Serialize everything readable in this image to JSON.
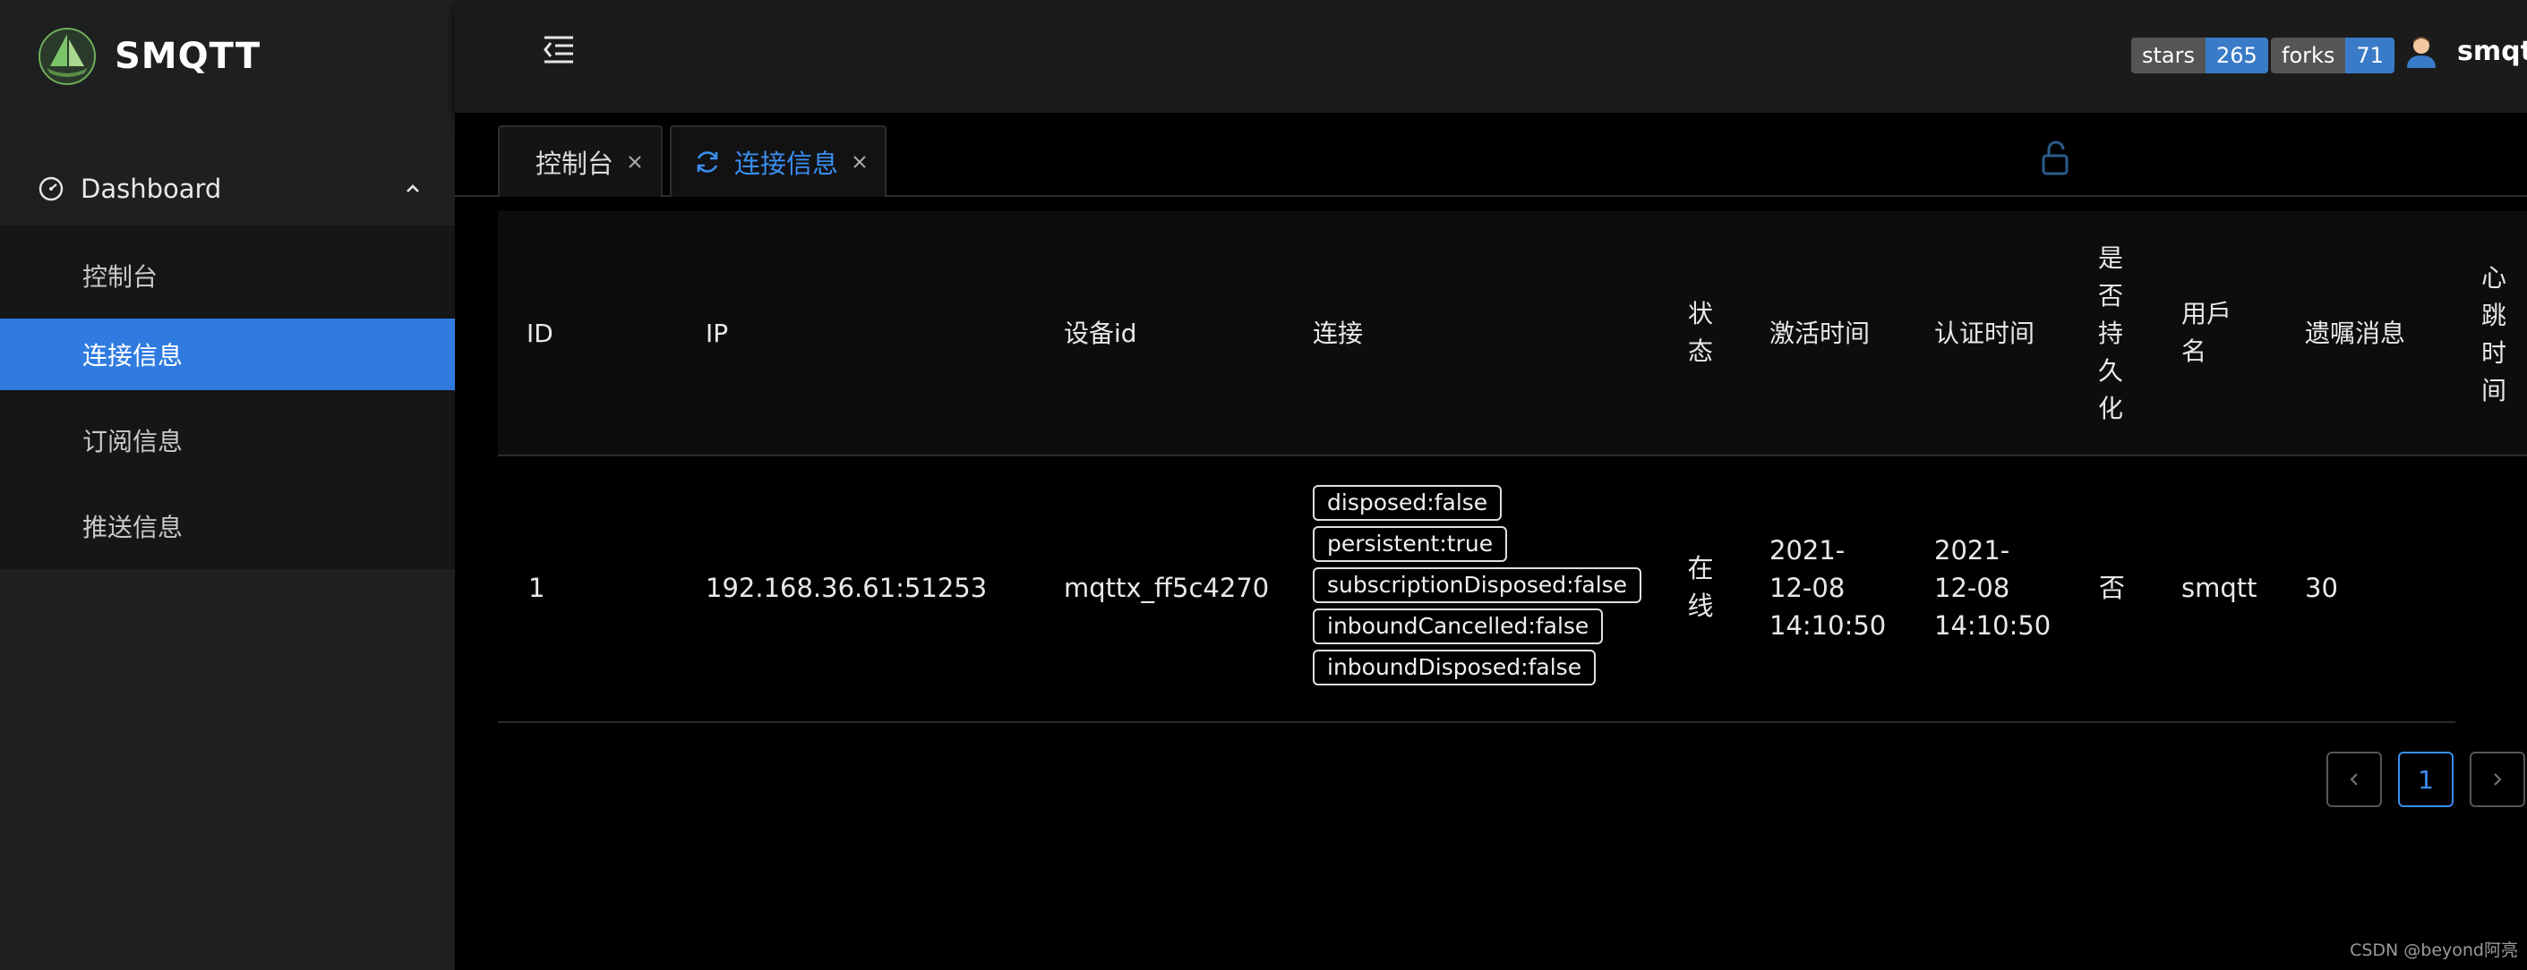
{
  "app": {
    "title": "SMQTT"
  },
  "sidebar": {
    "group_label": "Dashboard",
    "items": [
      {
        "label": "控制台"
      },
      {
        "label": "连接信息"
      },
      {
        "label": "订阅信息"
      },
      {
        "label": "推送信息"
      }
    ],
    "active_index": 1
  },
  "header": {
    "stars": {
      "label": "stars",
      "value": "265"
    },
    "forks": {
      "label": "forks",
      "value": "71"
    },
    "username": "smqtt"
  },
  "tabs": [
    {
      "label": "控制台"
    },
    {
      "label": "连接信息"
    }
  ],
  "table": {
    "columns": [
      "ID",
      "IP",
      "设备id",
      "连接",
      "状态",
      "激活时间",
      "认证时间",
      "是否持久化",
      "用戶名",
      "遗嘱消息",
      "心跳时间"
    ],
    "rows": [
      {
        "id": "1",
        "ip": "192.168.36.61:51253",
        "device_id": "mqttx_ff5c4270",
        "connection_tags": [
          "disposed:false",
          "persistent:true",
          "subscriptionDisposed:false",
          "inboundCancelled:false",
          "inboundDisposed:false"
        ],
        "status": "在线",
        "activated_date": "2021-\n12-08",
        "activated_time": "14:10:50",
        "auth_date": "2021-\n12-08",
        "auth_time": "14:10:50",
        "persistent": "否",
        "username": "smqtt",
        "will_message": "30"
      }
    ]
  },
  "pagination": {
    "current": "1",
    "prev": "<",
    "next": ">"
  },
  "watermark": "CSDN @beyond阿亮",
  "colors": {
    "accent": "#2f7be0",
    "sidebar_bg": "#1e1f20",
    "badge_value": "#3a7bc8"
  }
}
